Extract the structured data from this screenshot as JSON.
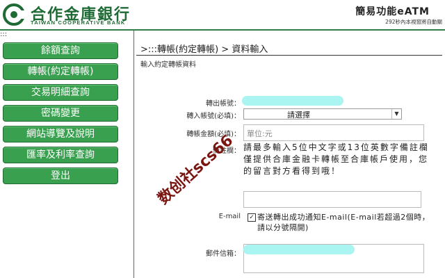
{
  "header": {
    "logo_cn": "合作金庫銀行",
    "logo_en": "TAIWAN COOPERATIVE BANK",
    "title": "簡易功能eATM",
    "notice": "292秒內本視窗將自動關"
  },
  "sidebar": {
    "breadcrumb": ":::",
    "items": [
      {
        "label": "餘額查詢"
      },
      {
        "label": "轉帳(約定轉帳)"
      },
      {
        "label": "交易明細查詢"
      },
      {
        "label": "密碼變更"
      },
      {
        "label": "網站導覽及說明"
      },
      {
        "label": "匯率及利率查詢"
      },
      {
        "label": "登出"
      }
    ]
  },
  "main": {
    "path": ">:::轉帳(約定轉帳) > 資料輸入",
    "subhead": "輸入約定轉帳資料",
    "form": {
      "from_account_label": "轉出帳號：",
      "to_account_label": "轉入帳號(必填)：",
      "to_account_selected": "請選擇",
      "amount_label": "轉帳金額(必填)：",
      "amount_placeholder": "單位:元",
      "memo_label": "備註欄：",
      "memo_hint": "請最多輸入5位中文字或13位英數字備註欄僅提供合庫金融卡轉帳至合庫帳戶使用，您的留言對方看得到哦！",
      "email_label": "E-mail",
      "email_check_text": "寄送轉出成功通知E-mail(E-mail若超過2個時，請以分號隔開)",
      "mailbox_label": "郵件信箱："
    }
  },
  "watermark": "数创社scs66",
  "colors": {
    "menu_green": "#38a04e",
    "brand_green": "#1f6b35",
    "mask_cyan": "#aaf4f2"
  }
}
